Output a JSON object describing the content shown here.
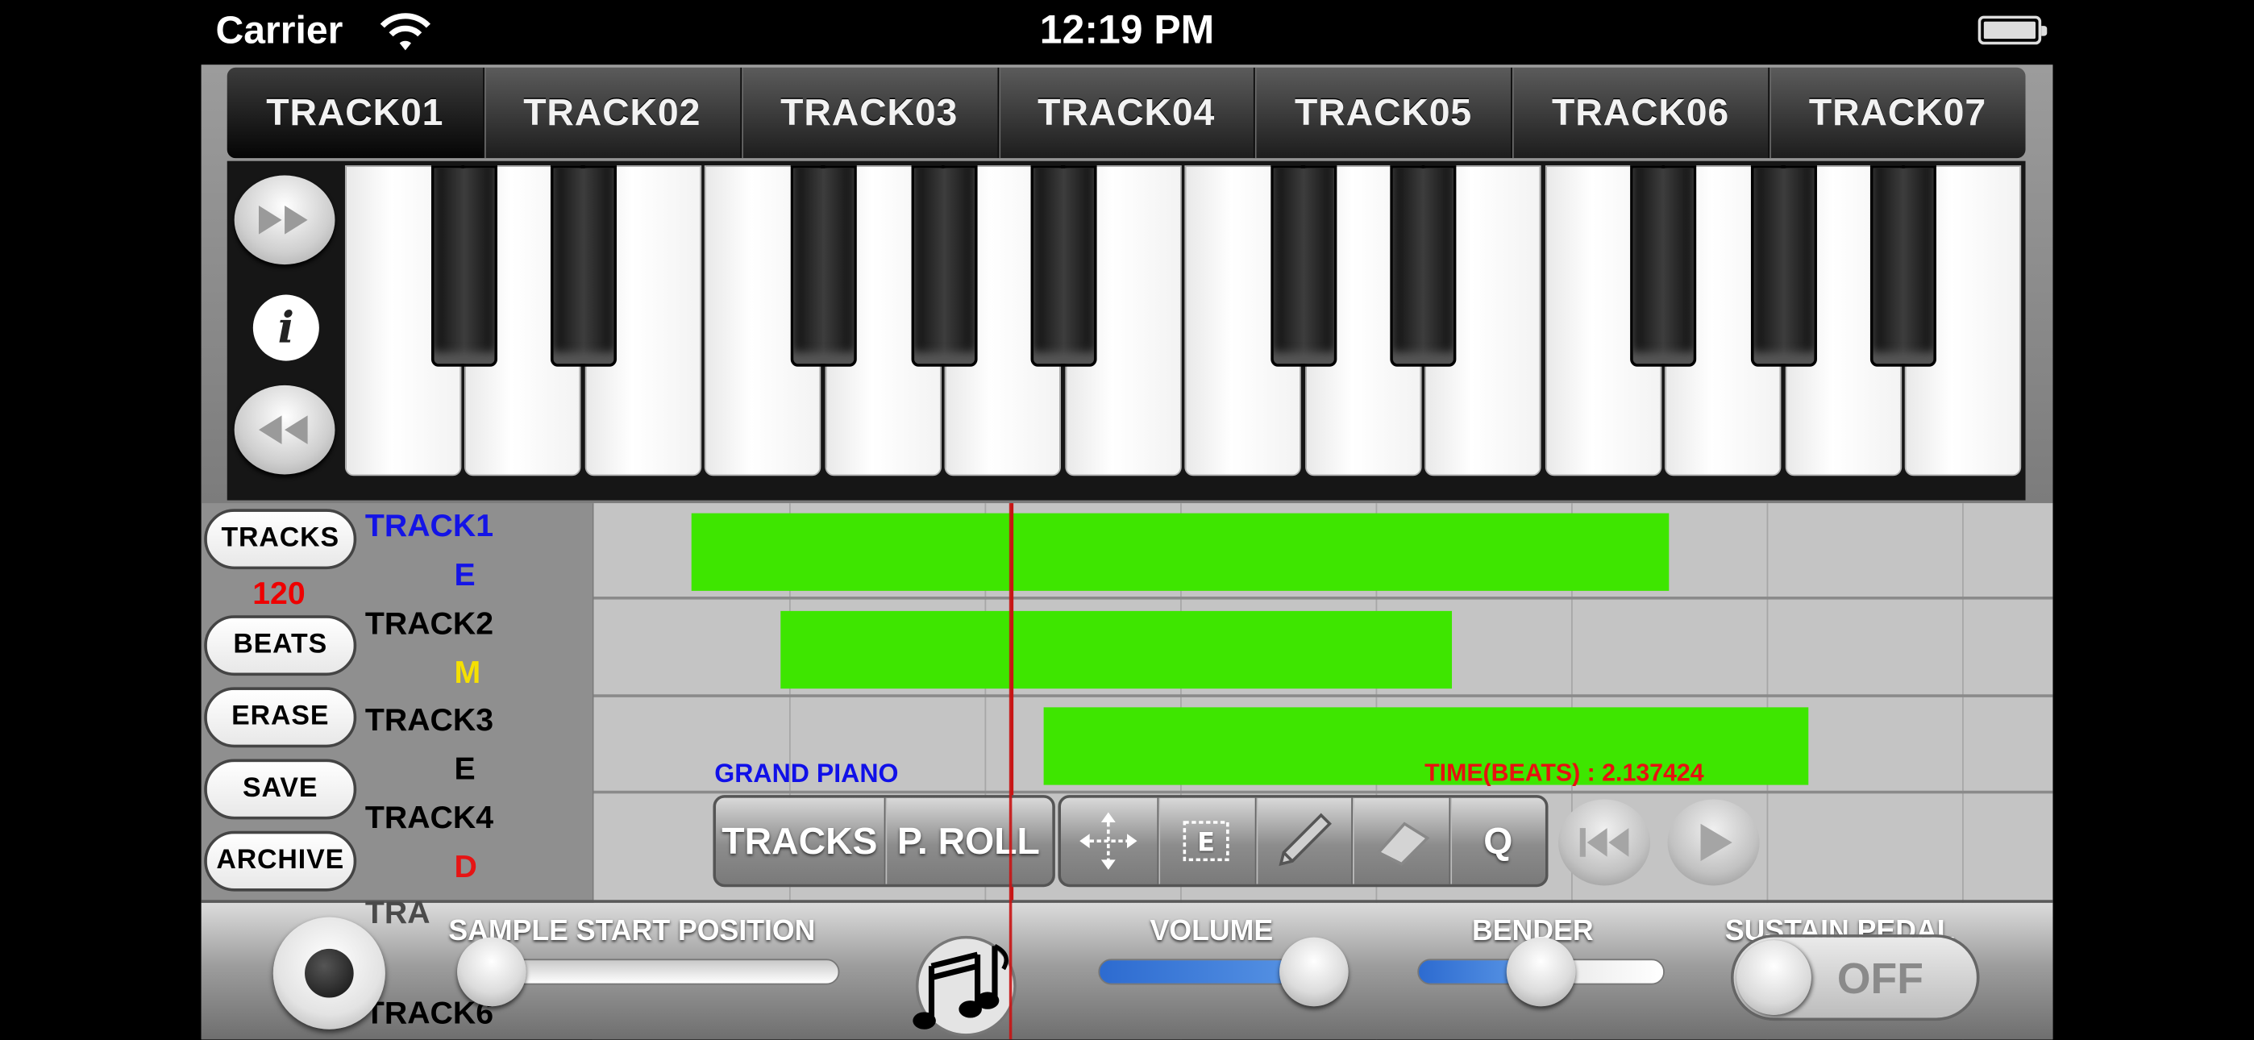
{
  "status_bar": {
    "carrier": "Carrier",
    "time": "12:19 PM",
    "wifi_icon": "wifi-icon",
    "battery_icon": "battery-icon"
  },
  "tabs": [
    "TRACK01",
    "TRACK02",
    "TRACK03",
    "TRACK04",
    "TRACK05",
    "TRACK06",
    "TRACK07"
  ],
  "keyboard": {
    "fast_forward_icon": "fast-forward-icon",
    "info_icon": "info-icon",
    "info_glyph": "i",
    "rewind_icon": "rewind-icon"
  },
  "left_panel": {
    "tracks_label": "TRACKS",
    "tempo": "120",
    "beats_label": "BEATS",
    "erase_label": "ERASE",
    "save_label": "SAVE",
    "archive_label": "ARCHIVE"
  },
  "track_list": [
    {
      "name": "TRACK1",
      "mode": "E",
      "mode_color": "#1414e6"
    },
    {
      "name": "TRACK2",
      "mode": "M",
      "mode_color": "#f5e000"
    },
    {
      "name": "TRACK3",
      "mode": "E",
      "mode_color": "#000000"
    },
    {
      "name": "TRACK4",
      "mode": "D",
      "mode_color": "#e61414"
    },
    {
      "name": "TRA",
      "mode": "",
      "mode_color": "#e61414"
    },
    {
      "name": "TRACK6",
      "mode": "",
      "mode_color": "#000000"
    }
  ],
  "timeline": {
    "instrument": "GRAND PIANO",
    "time_beats": "TIME(BEATS) : 2.137424",
    "clip_color": "#3ee600",
    "playhead_color": "#c81414"
  },
  "toolbar": {
    "tracks_label": "TRACKS",
    "proll_label": "P. ROLL",
    "move_icon": "move-icon",
    "select_icon": "select-icon",
    "pencil_icon": "pencil-icon",
    "eraser_icon": "eraser-icon",
    "quantize_label": "Q",
    "skip_back_icon": "skip-back-icon",
    "play_icon": "play-icon"
  },
  "bottom_bar": {
    "record_icon": "record-icon",
    "sample_label": "SAMPLE START POSITION",
    "music_icon": "music-notes-icon",
    "volume_label": "VOLUME",
    "bender_label": "BENDER",
    "sustain_label": "SUSTAIN PEDAL",
    "sustain_value": "OFF",
    "slider_fill_color": "#3a79d8"
  }
}
